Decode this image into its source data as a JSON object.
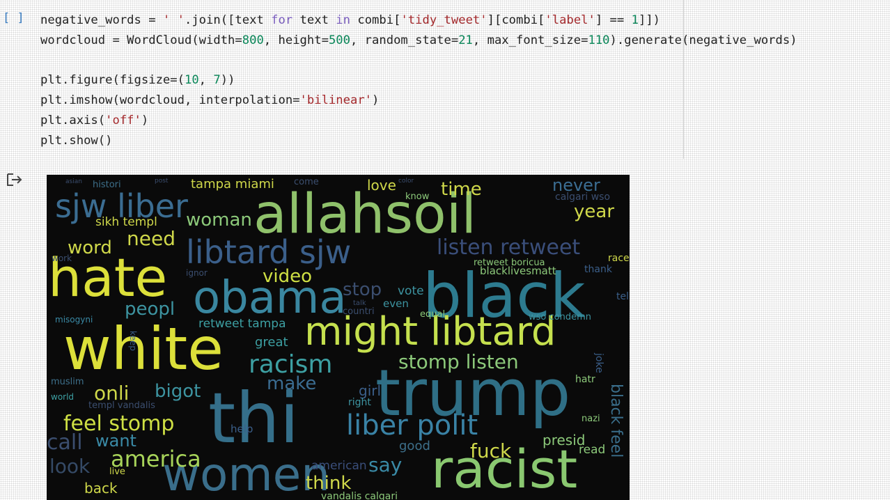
{
  "cell": {
    "bracket": "[ ]",
    "code_lines": [
      "negative_words = ' '.join([text for text in combi['tidy_tweet'][combi['label'] == 1]])",
      "wordcloud = WordCloud(width=800, height=500, random_state=21, max_font_size=110).generate(negative_words)",
      "",
      "plt.figure(figsize=(10, 7))",
      "plt.imshow(wordcloud, interpolation='bilinear')",
      "plt.axis('off')",
      "plt.show()"
    ]
  },
  "output": {
    "icon": "output-arrow-icon",
    "wordcloud_words": [
      {
        "text": "allahsoil",
        "color": "#8fc16b"
      },
      {
        "text": "black",
        "color": "#2d7b8f"
      },
      {
        "text": "trump",
        "color": "#2f6f86"
      },
      {
        "text": "white",
        "color": "#dce03a"
      },
      {
        "text": "hate",
        "color": "#dce03a"
      },
      {
        "text": "obama",
        "color": "#3a87a0"
      },
      {
        "text": "thi",
        "color": "#356f8a"
      },
      {
        "text": "women",
        "color": "#3a6e8b"
      },
      {
        "text": "racist",
        "color": "#8ac870"
      },
      {
        "text": "might libtard",
        "color": "#c5e04e"
      },
      {
        "text": "libtard sjw",
        "color": "#3b5f8a"
      },
      {
        "text": "sjw liber",
        "color": "#3b6d92"
      },
      {
        "text": "liber polit",
        "color": "#3a83a6"
      },
      {
        "text": "listen retweet",
        "color": "#3a4e7a"
      },
      {
        "text": "stomp listen",
        "color": "#8cc97a"
      },
      {
        "text": "racism",
        "color": "#3da0a3"
      },
      {
        "text": "feel stomp",
        "color": "#cfe044"
      },
      {
        "text": "america",
        "color": "#a8d45a"
      },
      {
        "text": "woman",
        "color": "#8cc97a"
      },
      {
        "text": "need",
        "color": "#cfd84a"
      },
      {
        "text": "word",
        "color": "#cfd84a"
      },
      {
        "text": "video",
        "color": "#cfe044"
      },
      {
        "text": "peopl",
        "color": "#3d94a1"
      },
      {
        "text": "onli",
        "color": "#cfd84a"
      },
      {
        "text": "bigot",
        "color": "#3d94a1"
      },
      {
        "text": "make",
        "color": "#3b6d92"
      },
      {
        "text": "call",
        "color": "#3b4e6f"
      },
      {
        "text": "want",
        "color": "#3a8aa6"
      },
      {
        "text": "look",
        "color": "#354a66"
      },
      {
        "text": "think",
        "color": "#cfd84a"
      },
      {
        "text": "back",
        "color": "#cfd84a"
      },
      {
        "text": "say",
        "color": "#3a8aa6"
      },
      {
        "text": "fuck",
        "color": "#cfd84a"
      },
      {
        "text": "presid",
        "color": "#8cc97a"
      },
      {
        "text": "read",
        "color": "#8cc97a"
      },
      {
        "text": "good",
        "color": "#3d6f8a"
      },
      {
        "text": "great",
        "color": "#3da0a3"
      },
      {
        "text": "stop",
        "color": "#3b4e6f"
      },
      {
        "text": "vote",
        "color": "#3d94a1"
      },
      {
        "text": "even",
        "color": "#3d94a1"
      },
      {
        "text": "love",
        "color": "#cfd84a"
      },
      {
        "text": "time",
        "color": "#cfd84a"
      },
      {
        "text": "never",
        "color": "#3b6d92"
      },
      {
        "text": "year",
        "color": "#cfd84a"
      },
      {
        "text": "tampa miami",
        "color": "#cfd84a"
      },
      {
        "text": "retweet tampa",
        "color": "#3da0a3"
      },
      {
        "text": "sikh templ",
        "color": "#cfd84a"
      },
      {
        "text": "histori",
        "color": "#3d6f8a"
      },
      {
        "text": "black feel",
        "color": "#3a6e8b"
      },
      {
        "text": "vandalis calgari",
        "color": "#8cc97a"
      },
      {
        "text": "american",
        "color": "#3a4e7a"
      },
      {
        "text": "retweet boricua",
        "color": "#8cc97a"
      },
      {
        "text": "blacklivesmatt",
        "color": "#8cc97a"
      },
      {
        "text": "wso condemn",
        "color": "#3d94a1"
      },
      {
        "text": "calgari wso",
        "color": "#3b4e6f"
      },
      {
        "text": "thank",
        "color": "#3b5f8a"
      },
      {
        "text": "race",
        "color": "#cfd84a"
      },
      {
        "text": "know",
        "color": "#8cc97a"
      },
      {
        "text": "equal",
        "color": "#8cc97a"
      },
      {
        "text": "muslim",
        "color": "#3d6f8a"
      },
      {
        "text": "world",
        "color": "#3da0a3"
      },
      {
        "text": "templ vandalis",
        "color": "#3b4e6f"
      },
      {
        "text": "girl",
        "color": "#3b5f8a"
      },
      {
        "text": "right",
        "color": "#3d94a1"
      },
      {
        "text": "nazi",
        "color": "#8cc97a"
      },
      {
        "text": "hatr",
        "color": "#8cc97a"
      },
      {
        "text": "help",
        "color": "#3b5f8a"
      },
      {
        "text": "misogyni",
        "color": "#3a8aa6"
      },
      {
        "text": "live",
        "color": "#cfd84a"
      },
      {
        "text": "countri",
        "color": "#3b4e6f"
      },
      {
        "text": "tell",
        "color": "#3b5f8a"
      },
      {
        "text": "joke",
        "color": "#3b5f8a"
      },
      {
        "text": "keep",
        "color": "#3b5f8a"
      },
      {
        "text": "ignor",
        "color": "#3b4e6f"
      },
      {
        "text": "come",
        "color": "#3b4e6f"
      },
      {
        "text": "asian",
        "color": "#3b4e6f"
      },
      {
        "text": "post",
        "color": "#3b4e6f"
      },
      {
        "text": "talk",
        "color": "#3b4e6f"
      },
      {
        "text": "color",
        "color": "#3b4e6f"
      },
      {
        "text": "work",
        "color": "#3b4e6f"
      }
    ]
  }
}
